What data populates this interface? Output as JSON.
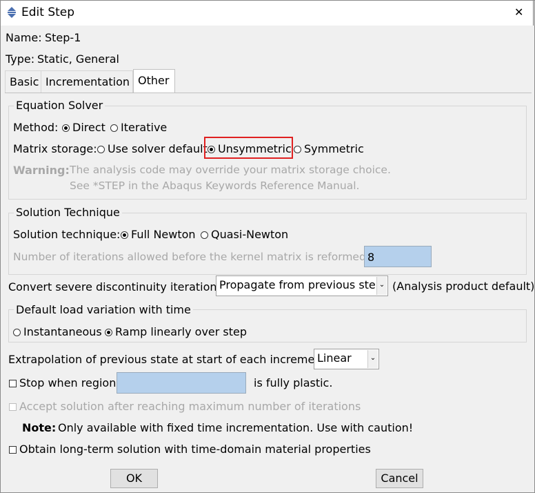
{
  "window": {
    "title": "Edit Step",
    "close_glyph": "✕"
  },
  "name": {
    "label": "Name:",
    "value": "Step-1"
  },
  "type": {
    "label": "Type:",
    "value": "Static, General"
  },
  "tabs": [
    {
      "label": "Basic",
      "active": false
    },
    {
      "label": "Incrementation",
      "active": false
    },
    {
      "label": "Other",
      "active": true
    }
  ],
  "equation_solver": {
    "title": "Equation Solver",
    "method_label": "Method:",
    "method_options": [
      {
        "label": "Direct",
        "selected": true
      },
      {
        "label": "Iterative",
        "selected": false
      }
    ],
    "matrix_storage_label": "Matrix storage:",
    "matrix_storage_options": [
      {
        "label": "Use solver default",
        "selected": false
      },
      {
        "label": "Unsymmetric",
        "selected": true
      },
      {
        "label": "Symmetric",
        "selected": false
      }
    ],
    "warning_label": "Warning:",
    "warning_line1": "The analysis code may override your matrix storage choice.",
    "warning_line2": "See *STEP in the Abaqus Keywords Reference Manual."
  },
  "solution_technique": {
    "title": "Solution Technique",
    "label": "Solution technique:",
    "options": [
      {
        "label": "Full Newton",
        "selected": true
      },
      {
        "label": "Quasi-Newton",
        "selected": false
      }
    ],
    "iterations_label": "Number of iterations allowed before the kernel matrix is reformed:",
    "iterations_value": "8"
  },
  "discontinuity": {
    "label": "Convert severe discontinuity iterations:",
    "value": "Propagate from previous step",
    "note": "(Analysis product default)"
  },
  "load_variation": {
    "title": "Default load variation with time",
    "options": [
      {
        "label": "Instantaneous",
        "selected": false
      },
      {
        "label": "Ramp linearly over step",
        "selected": true
      }
    ]
  },
  "extrapolation": {
    "label": "Extrapolation of previous state at start of each increment:",
    "value": "Linear"
  },
  "stop_region": {
    "label": "Stop when region",
    "suffix": "is fully plastic.",
    "checked": false,
    "value": ""
  },
  "accept_solution": {
    "label": "Accept solution after reaching maximum number of iterations",
    "checked": false,
    "enabled": false
  },
  "note": {
    "label": "Note:",
    "text": "Only available with fixed time incrementation. Use with caution!"
  },
  "long_term": {
    "label": "Obtain long-term solution with time-domain material properties",
    "checked": false
  },
  "buttons": {
    "ok": "OK",
    "cancel": "Cancel"
  },
  "icons": {
    "app": "abaqus-step-icon",
    "dropdown": "chevron-down-icon"
  }
}
